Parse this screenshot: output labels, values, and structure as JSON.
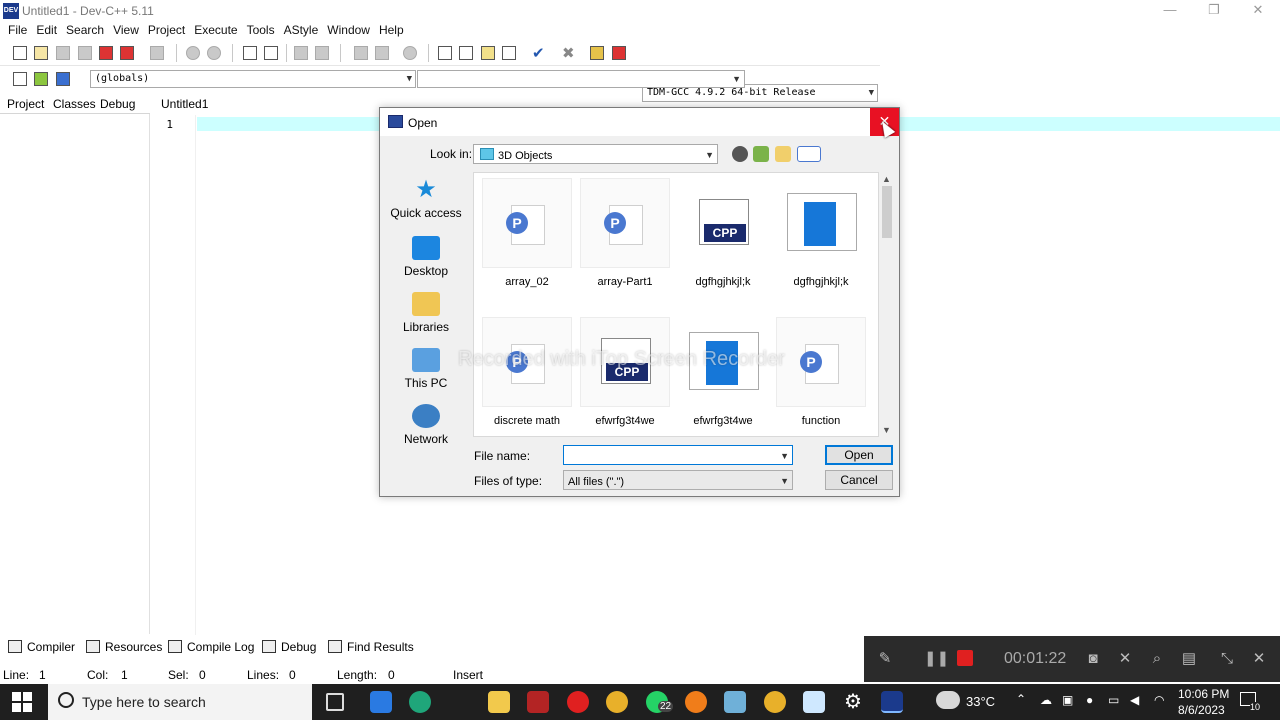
{
  "window": {
    "title": "Untitled1 - Dev-C++ 5.11",
    "app_icon_text": "DEV"
  },
  "menu": [
    "File",
    "Edit",
    "Search",
    "View",
    "Project",
    "Execute",
    "Tools",
    "AStyle",
    "Window",
    "Help"
  ],
  "toolbar": {
    "compiler_select": "TDM-GCC 4.9.2 64-bit Release",
    "globals_select": "(globals)",
    "members_select": ""
  },
  "left_panel": {
    "tabs": [
      "Project",
      "Classes",
      "Debug"
    ]
  },
  "editor": {
    "tab": "Untitled1",
    "line_number": "1"
  },
  "bottom_tabs": [
    "Compiler",
    "Resources",
    "Compile Log",
    "Debug",
    "Find Results"
  ],
  "status": {
    "line_label": "Line:",
    "line_value": "1",
    "col_label": "Col:",
    "col_value": "1",
    "sel_label": "Sel:",
    "sel_value": "0",
    "lines_label": "Lines:",
    "lines_value": "0",
    "length_label": "Length:",
    "length_value": "0",
    "mode": "Insert"
  },
  "recorder": {
    "time": "00:01:22",
    "watermark": "Recorded with iTop Screen Recorder"
  },
  "dialog": {
    "title": "Open",
    "look_in_label": "Look in:",
    "look_in_value": "3D Objects",
    "places": [
      "Quick access",
      "Desktop",
      "Libraries",
      "This PC",
      "Network"
    ],
    "files": [
      {
        "name": "array_02",
        "kind": "p-doc"
      },
      {
        "name": "array-Part1",
        "kind": "p-doc"
      },
      {
        "name": "dgfhgjhkjl;k",
        "kind": "cpp"
      },
      {
        "name": "dgfhgjhkjl;k",
        "kind": "screenshot"
      },
      {
        "name": "discrete math",
        "kind": "p-doc"
      },
      {
        "name": "efwrfg3t4we",
        "kind": "cpp"
      },
      {
        "name": "efwrfg3t4we",
        "kind": "screenshot"
      },
      {
        "name": "function",
        "kind": "p-doc"
      }
    ],
    "file_name_label": "File name:",
    "file_name_value": "",
    "files_of_type_label": "Files of type:",
    "files_of_type_value": "All files (\".\")",
    "open_button": "Open",
    "cancel_button": "Cancel",
    "cpp_badge": "CPP",
    "p_badge": "P"
  },
  "taskbar": {
    "search_placeholder": "Type here to search",
    "whatsapp_badge": "22",
    "weather": "33°C",
    "time": "10:06 PM",
    "date": "8/6/2023",
    "notifications": "10"
  },
  "colors": {
    "current_line": "#ccffff",
    "close_red": "#e81123",
    "focus_blue": "#0078d7",
    "recorder_bg": "#2b2b2b",
    "taskbar_bg": "#1f1f1f"
  }
}
